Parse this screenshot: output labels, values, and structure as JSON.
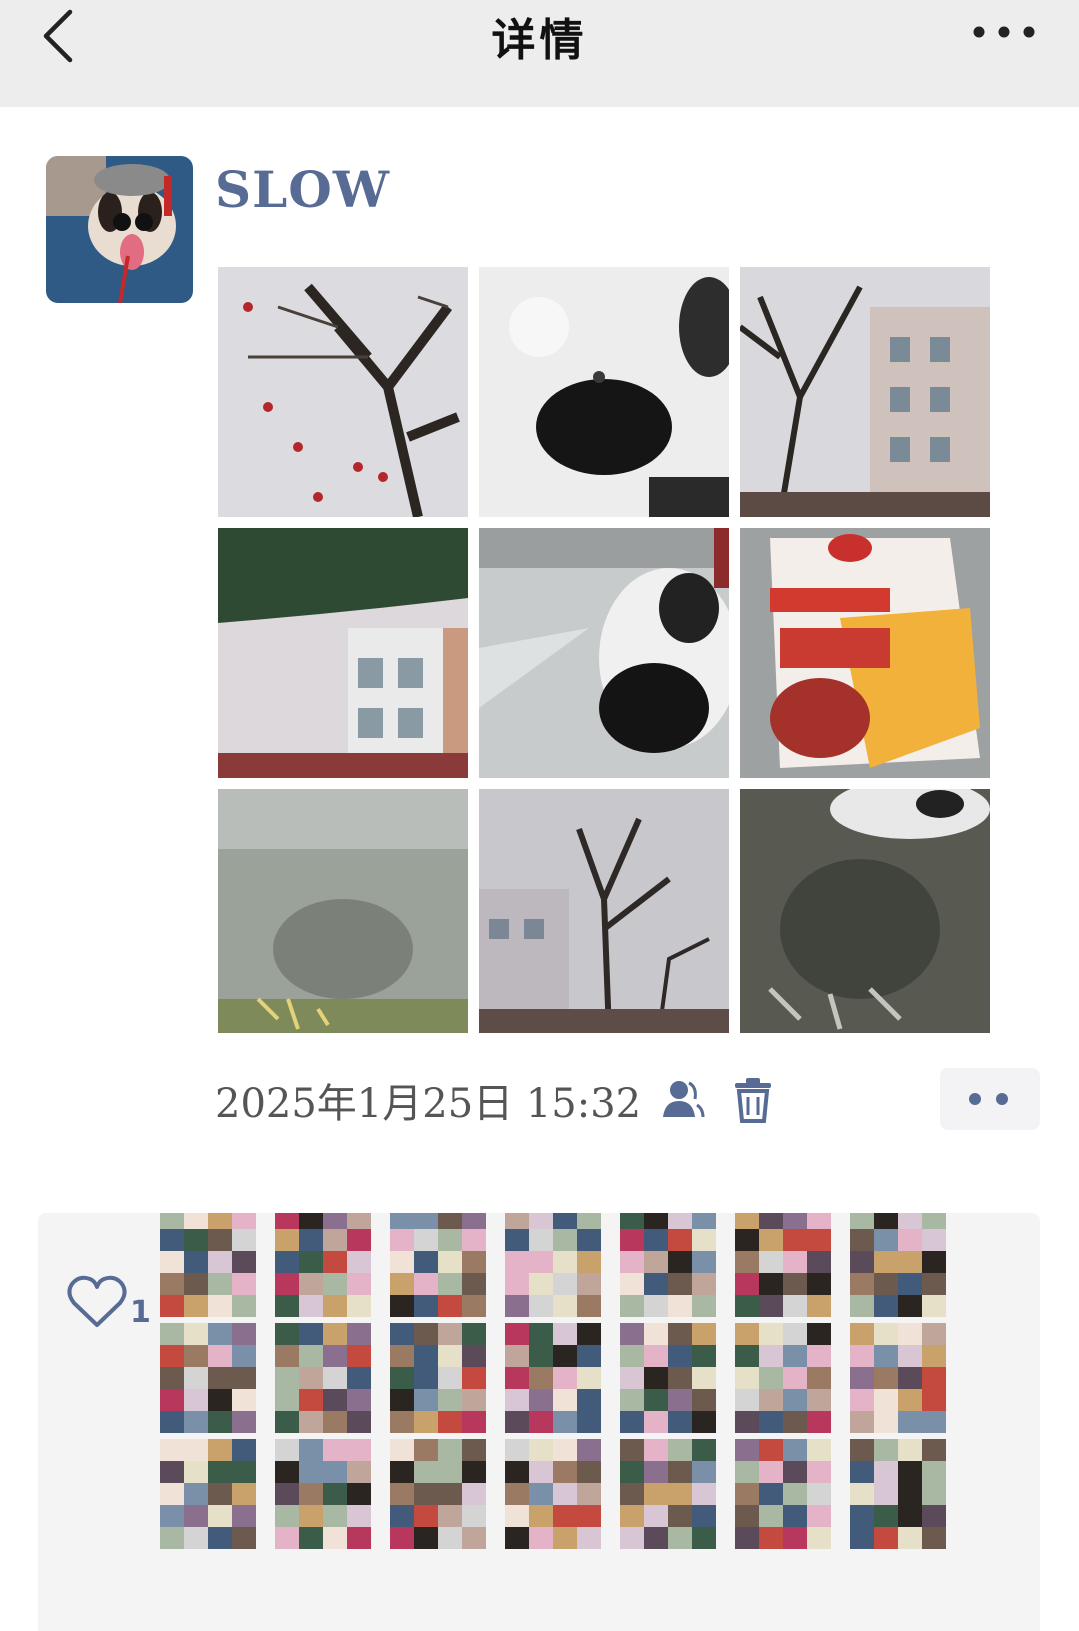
{
  "nav": {
    "title": "详情",
    "back_icon": "chevron-left-icon",
    "more_icon": "ellipsis-icon"
  },
  "post": {
    "username": "SLOW",
    "photos": [
      "tree-with-red-lanterns",
      "panda-plush-closeup",
      "tree-and-apartment-buildings",
      "green-umbrella-and-buildings",
      "panda-plush-by-window",
      "snack-bag-packaging",
      "blurry-reflection-on-glass",
      "bare-tree-skyline",
      "reflection-with-panda-plush"
    ],
    "timestamp": "2025年1月25日 15:32"
  },
  "likes": {
    "count": "1",
    "heart_icon": "heart-outline-icon"
  },
  "colors": {
    "nav_bg": "#ededed",
    "name_link": "#576b95",
    "likes_bg": "#f4f4f4"
  }
}
